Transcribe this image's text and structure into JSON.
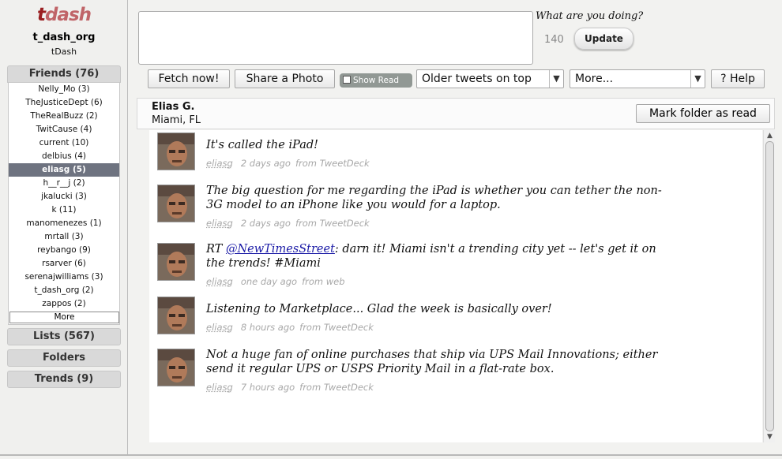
{
  "logo": {
    "t": "t",
    "dash": "dash"
  },
  "account": {
    "name": "t_dash_org",
    "sub": "tDash"
  },
  "sidebar": {
    "friends_header": "Friends (76)",
    "friends": [
      {
        "label": "Nelly_Mo (3)",
        "selected": false
      },
      {
        "label": "TheJusticeDept (6)",
        "selected": false
      },
      {
        "label": "TheRealBuzz (2)",
        "selected": false
      },
      {
        "label": "TwitCause (4)",
        "selected": false
      },
      {
        "label": "current (10)",
        "selected": false
      },
      {
        "label": "delbius (4)",
        "selected": false
      },
      {
        "label": "eliasg (5)",
        "selected": true
      },
      {
        "label": "h__r__j (2)",
        "selected": false
      },
      {
        "label": "jkalucki (3)",
        "selected": false
      },
      {
        "label": "k (11)",
        "selected": false
      },
      {
        "label": "manomenezes (1)",
        "selected": false
      },
      {
        "label": "mrtall (3)",
        "selected": false
      },
      {
        "label": "reybango (9)",
        "selected": false
      },
      {
        "label": "rsarver (6)",
        "selected": false
      },
      {
        "label": "serenajwilliams (3)",
        "selected": false
      },
      {
        "label": "t_dash_org (2)",
        "selected": false
      },
      {
        "label": "zappos (2)",
        "selected": false
      }
    ],
    "more_label": "More",
    "lists_header": "Lists (567)",
    "folders_header": "Folders",
    "trends_header": "Trends (9)"
  },
  "composer": {
    "prompt": "What are you doing?",
    "char_count": "140",
    "update_label": "Update",
    "value": ""
  },
  "toolbar": {
    "fetch_label": "Fetch now!",
    "share_photo_label": "Share a Photo",
    "show_read_label": "Show Read",
    "order_value": "Older tweets on top",
    "more_value": "More...",
    "help_label": "? Help"
  },
  "folder": {
    "name": "Elias G.",
    "location": "Miami, FL",
    "mark_read_label": "Mark folder as read"
  },
  "tweets": [
    {
      "pre": "It's called the iPad!",
      "mention": "",
      "post": "",
      "user": "eliasg",
      "time": "2 days ago",
      "source": "from TweetDeck"
    },
    {
      "pre": "The big question for me regarding the iPad is whether you can tether the non-3G model to an iPhone like you would for a laptop.",
      "mention": "",
      "post": "",
      "user": "eliasg",
      "time": "2 days ago",
      "source": "from TweetDeck"
    },
    {
      "pre": "RT ",
      "mention": "@NewTimesStreet",
      "post": ": darn it! Miami isn't a trending city yet -- let's get it on the trends! #Miami",
      "user": "eliasg",
      "time": "one day ago",
      "source": "from web"
    },
    {
      "pre": "Listening to Marketplace... Glad the week is basically over!",
      "mention": "",
      "post": "",
      "user": "eliasg",
      "time": "8 hours ago",
      "source": "from TweetDeck"
    },
    {
      "pre": "Not a huge fan of online purchases that ship via UPS Mail Innovations; either send it regular UPS or USPS Priority Mail in a flat-rate box.",
      "mention": "",
      "post": "",
      "user": "eliasg",
      "time": "7 hours ago",
      "source": "from TweetDeck"
    }
  ],
  "colors": {
    "brand_dark": "#9a1f21",
    "brand_light": "#c06468",
    "selected_row": "#6e7380",
    "link": "#1a1aa6"
  },
  "icons": {
    "select_arrow": "chevron-down-icon",
    "scroll_up": "scroll-up-arrow-icon",
    "scroll_down": "scroll-down-arrow-icon",
    "avatar": "user-avatar"
  }
}
